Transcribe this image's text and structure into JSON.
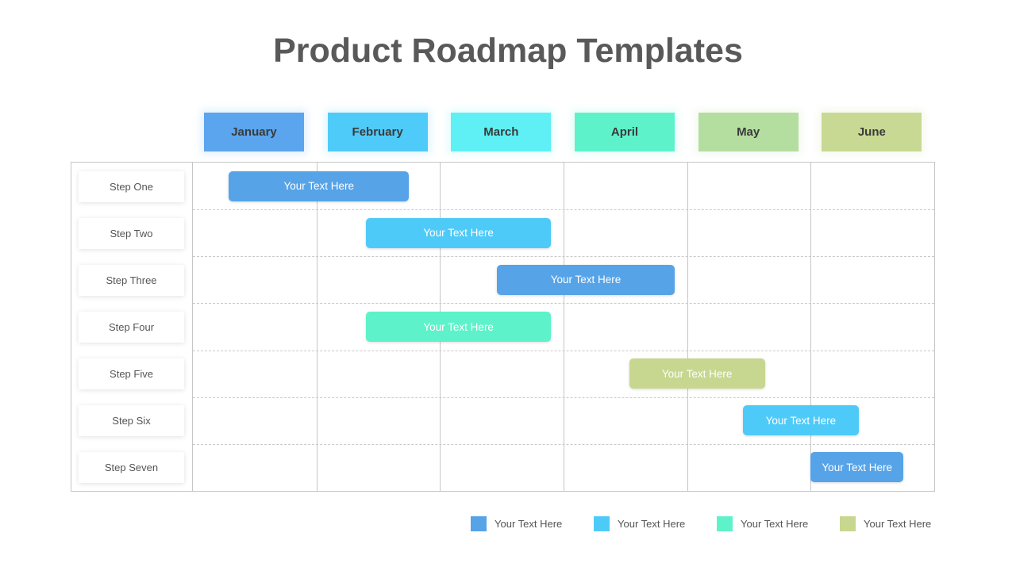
{
  "title": "Product Roadmap Templates",
  "chart_data": {
    "type": "gantt",
    "title": "Product Roadmap Templates",
    "months": [
      {
        "label": "January",
        "color": "#5aa5ee"
      },
      {
        "label": "February",
        "color": "#4fcbfa"
      },
      {
        "label": "March",
        "color": "#5ef0f4"
      },
      {
        "label": "April",
        "color": "#5ef2cb"
      },
      {
        "label": "May",
        "color": "#b3dea0"
      },
      {
        "label": "June",
        "color": "#c8d993"
      }
    ],
    "x_unit": "months from start of January",
    "xlim": [
      0,
      6
    ],
    "tasks": [
      {
        "step": "Step One",
        "label": "Your Text Here",
        "start": 0.29,
        "end": 1.75,
        "color": "#56a3e8"
      },
      {
        "step": "Step Two",
        "label": "Your Text Here",
        "start": 1.4,
        "end": 2.9,
        "color": "#4ecaf8"
      },
      {
        "step": "Step Three",
        "label": "Your Text Here",
        "start": 2.46,
        "end": 3.9,
        "color": "#56a3e8"
      },
      {
        "step": "Step Four",
        "label": "Your Text Here",
        "start": 1.4,
        "end": 2.9,
        "color": "#5ef2ca"
      },
      {
        "step": "Step Five",
        "label": "Your Text Here",
        "start": 3.53,
        "end": 4.63,
        "color": "#c7d78f"
      },
      {
        "step": "Step Six",
        "label": "Your Text Here",
        "start": 4.45,
        "end": 5.39,
        "color": "#4ecaf8"
      },
      {
        "step": "Step Seven",
        "label": "Your Text Here",
        "start": 5.0,
        "end": 5.75,
        "color": "#56a3e8"
      }
    ],
    "legend": [
      {
        "label": "Your Text Here",
        "color": "#56a3e8"
      },
      {
        "label": "Your Text Here",
        "color": "#4ecaf8"
      },
      {
        "label": "Your Text Here",
        "color": "#5ef2ca"
      },
      {
        "label": "Your Text Here",
        "color": "#c7d78f"
      }
    ],
    "legend_position": "bottom-right",
    "grid": true
  }
}
